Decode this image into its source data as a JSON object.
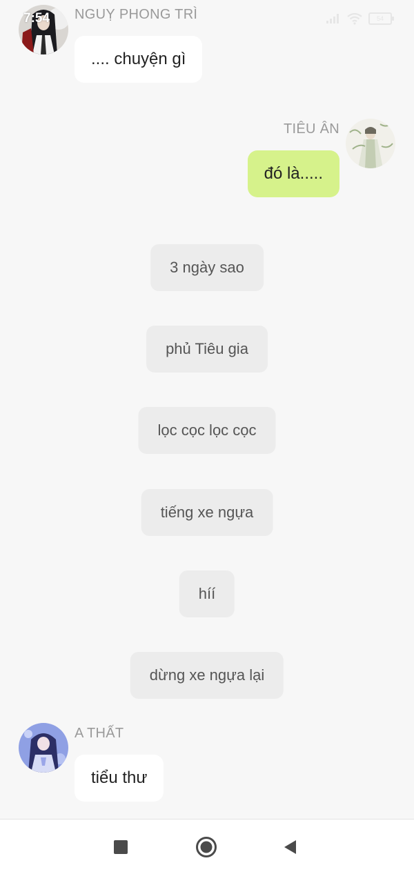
{
  "status_bar": {
    "time": "7:54",
    "battery": "54"
  },
  "messages": [
    {
      "sender": "NGUỴ PHONG TRÌ",
      "text": ".... chuyện gì"
    },
    {
      "sender": "TIÊU ÂN",
      "text": "đó là....."
    }
  ],
  "narrations": [
    "3 ngày sao",
    "phủ Tiêu gia",
    "lọc cọc lọc cọc",
    "tiếng xe ngựa",
    "híí",
    "dừng xe ngựa lại"
  ],
  "last_message": {
    "sender": "A THẤT",
    "text": "tiểu thư"
  },
  "colors": {
    "background": "#f7f7f7",
    "self_bubble": "#d6f28b",
    "other_bubble": "#ffffff",
    "narration_bubble": "#ececec"
  },
  "icons": {
    "nav_recents": "square-icon",
    "nav_home": "circle-icon",
    "nav_back": "triangle-back-icon"
  }
}
